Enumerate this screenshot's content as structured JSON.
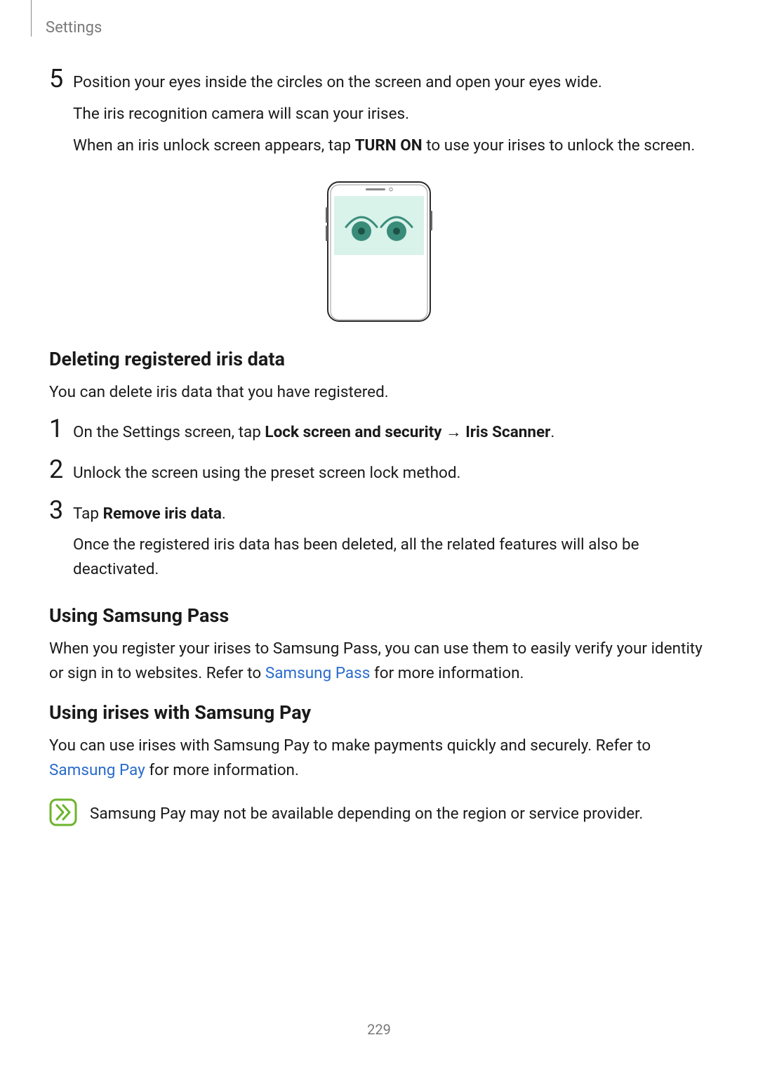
{
  "header": {
    "section_label": "Settings"
  },
  "step5": {
    "num": "5",
    "line1": "Position your eyes inside the circles on the screen and open your eyes wide.",
    "line2": "The iris recognition camera will scan your irises.",
    "line3_a": "When an iris unlock screen appears, tap ",
    "line3_bold": "TURN ON",
    "line3_b": " to use your irises to unlock the screen."
  },
  "deleting": {
    "heading": "Deleting registered iris data",
    "intro": "You can delete iris data that you have registered.",
    "item1": {
      "num": "1",
      "prefix": "On the Settings screen, tap ",
      "bold1": "Lock screen and security",
      "arrow": " → ",
      "bold2": "Iris Scanner",
      "suffix": "."
    },
    "item2": {
      "num": "2",
      "text": "Unlock the screen using the preset screen lock method."
    },
    "item3": {
      "num": "3",
      "prefix": "Tap ",
      "bold": "Remove iris data",
      "suffix": ".",
      "sub": "Once the registered iris data has been deleted, all the related features will also be deactivated."
    }
  },
  "samsung_pass": {
    "heading": "Using Samsung Pass",
    "body_a": "When you register your irises to Samsung Pass, you can use them to easily verify your identity or sign in to websites. Refer to ",
    "link": "Samsung Pass",
    "body_b": " for more information."
  },
  "samsung_pay": {
    "heading": "Using irises with Samsung Pay",
    "body_a": "You can use irises with Samsung Pay to make payments quickly and securely. Refer to ",
    "link": "Samsung Pay",
    "body_b": " for more information.",
    "note": "Samsung Pay may not be available depending on the region or service provider."
  },
  "page_number": "229"
}
